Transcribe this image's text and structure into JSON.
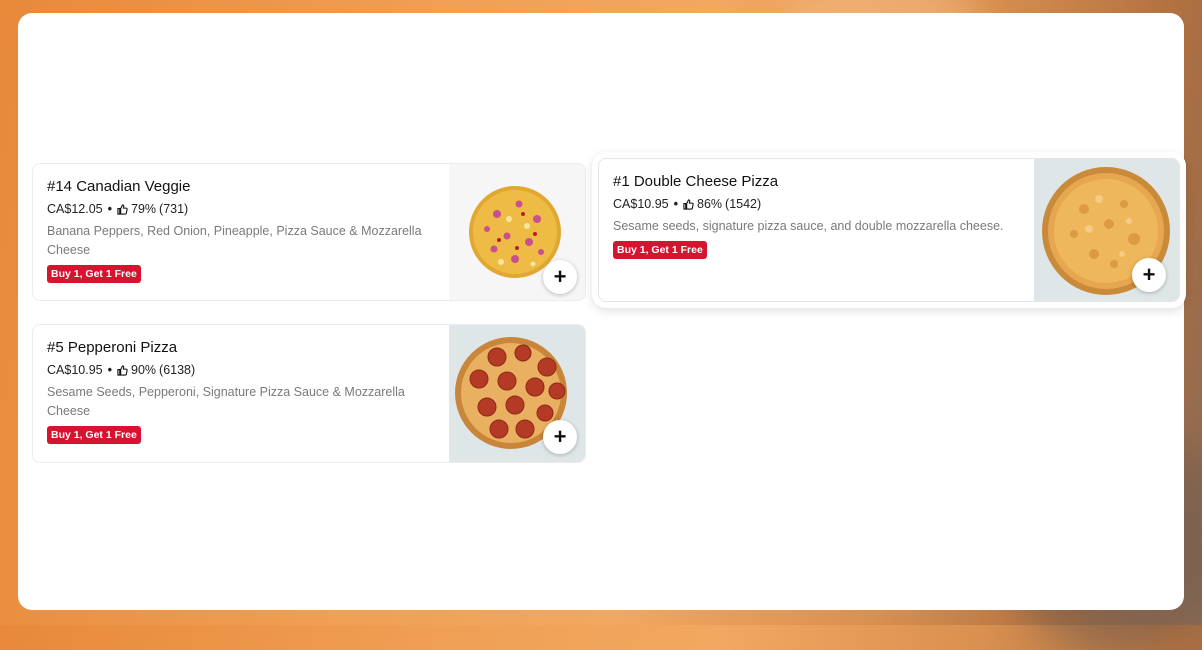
{
  "currency_prefix": "CA$",
  "items": [
    {
      "title": "#14 Canadian Veggie",
      "price": "CA$12.05",
      "rating": "79%",
      "reviews": "(731)",
      "description": "Banana Peppers, Red Onion, Pineapple, Pizza Sauce & Mozzarella Cheese",
      "promo": "Buy 1, Get 1 Free",
      "add_label": "+"
    },
    {
      "title": "#1 Double Cheese Pizza",
      "price": "CA$10.95",
      "rating": "86%",
      "reviews": "(1542)",
      "description": "Sesame seeds, signature pizza sauce, and double mozzarella cheese.",
      "promo": "Buy 1, Get 1 Free",
      "add_label": "+"
    },
    {
      "title": "#5 Pepperoni Pizza",
      "price": "CA$10.95",
      "rating": "90%",
      "reviews": "(6138)",
      "description": "Sesame Seeds, Pepperoni, Signature Pizza Sauce & Mozzarella Cheese",
      "promo": "Buy 1, Get 1 Free",
      "add_label": "+"
    }
  ],
  "colors": {
    "promo_badge": "#d6142f",
    "background_orange": "#f0a055",
    "panel": "#ffffff"
  },
  "icons": [
    "thumbs-up-icon",
    "plus-icon",
    "pizza-image"
  ]
}
